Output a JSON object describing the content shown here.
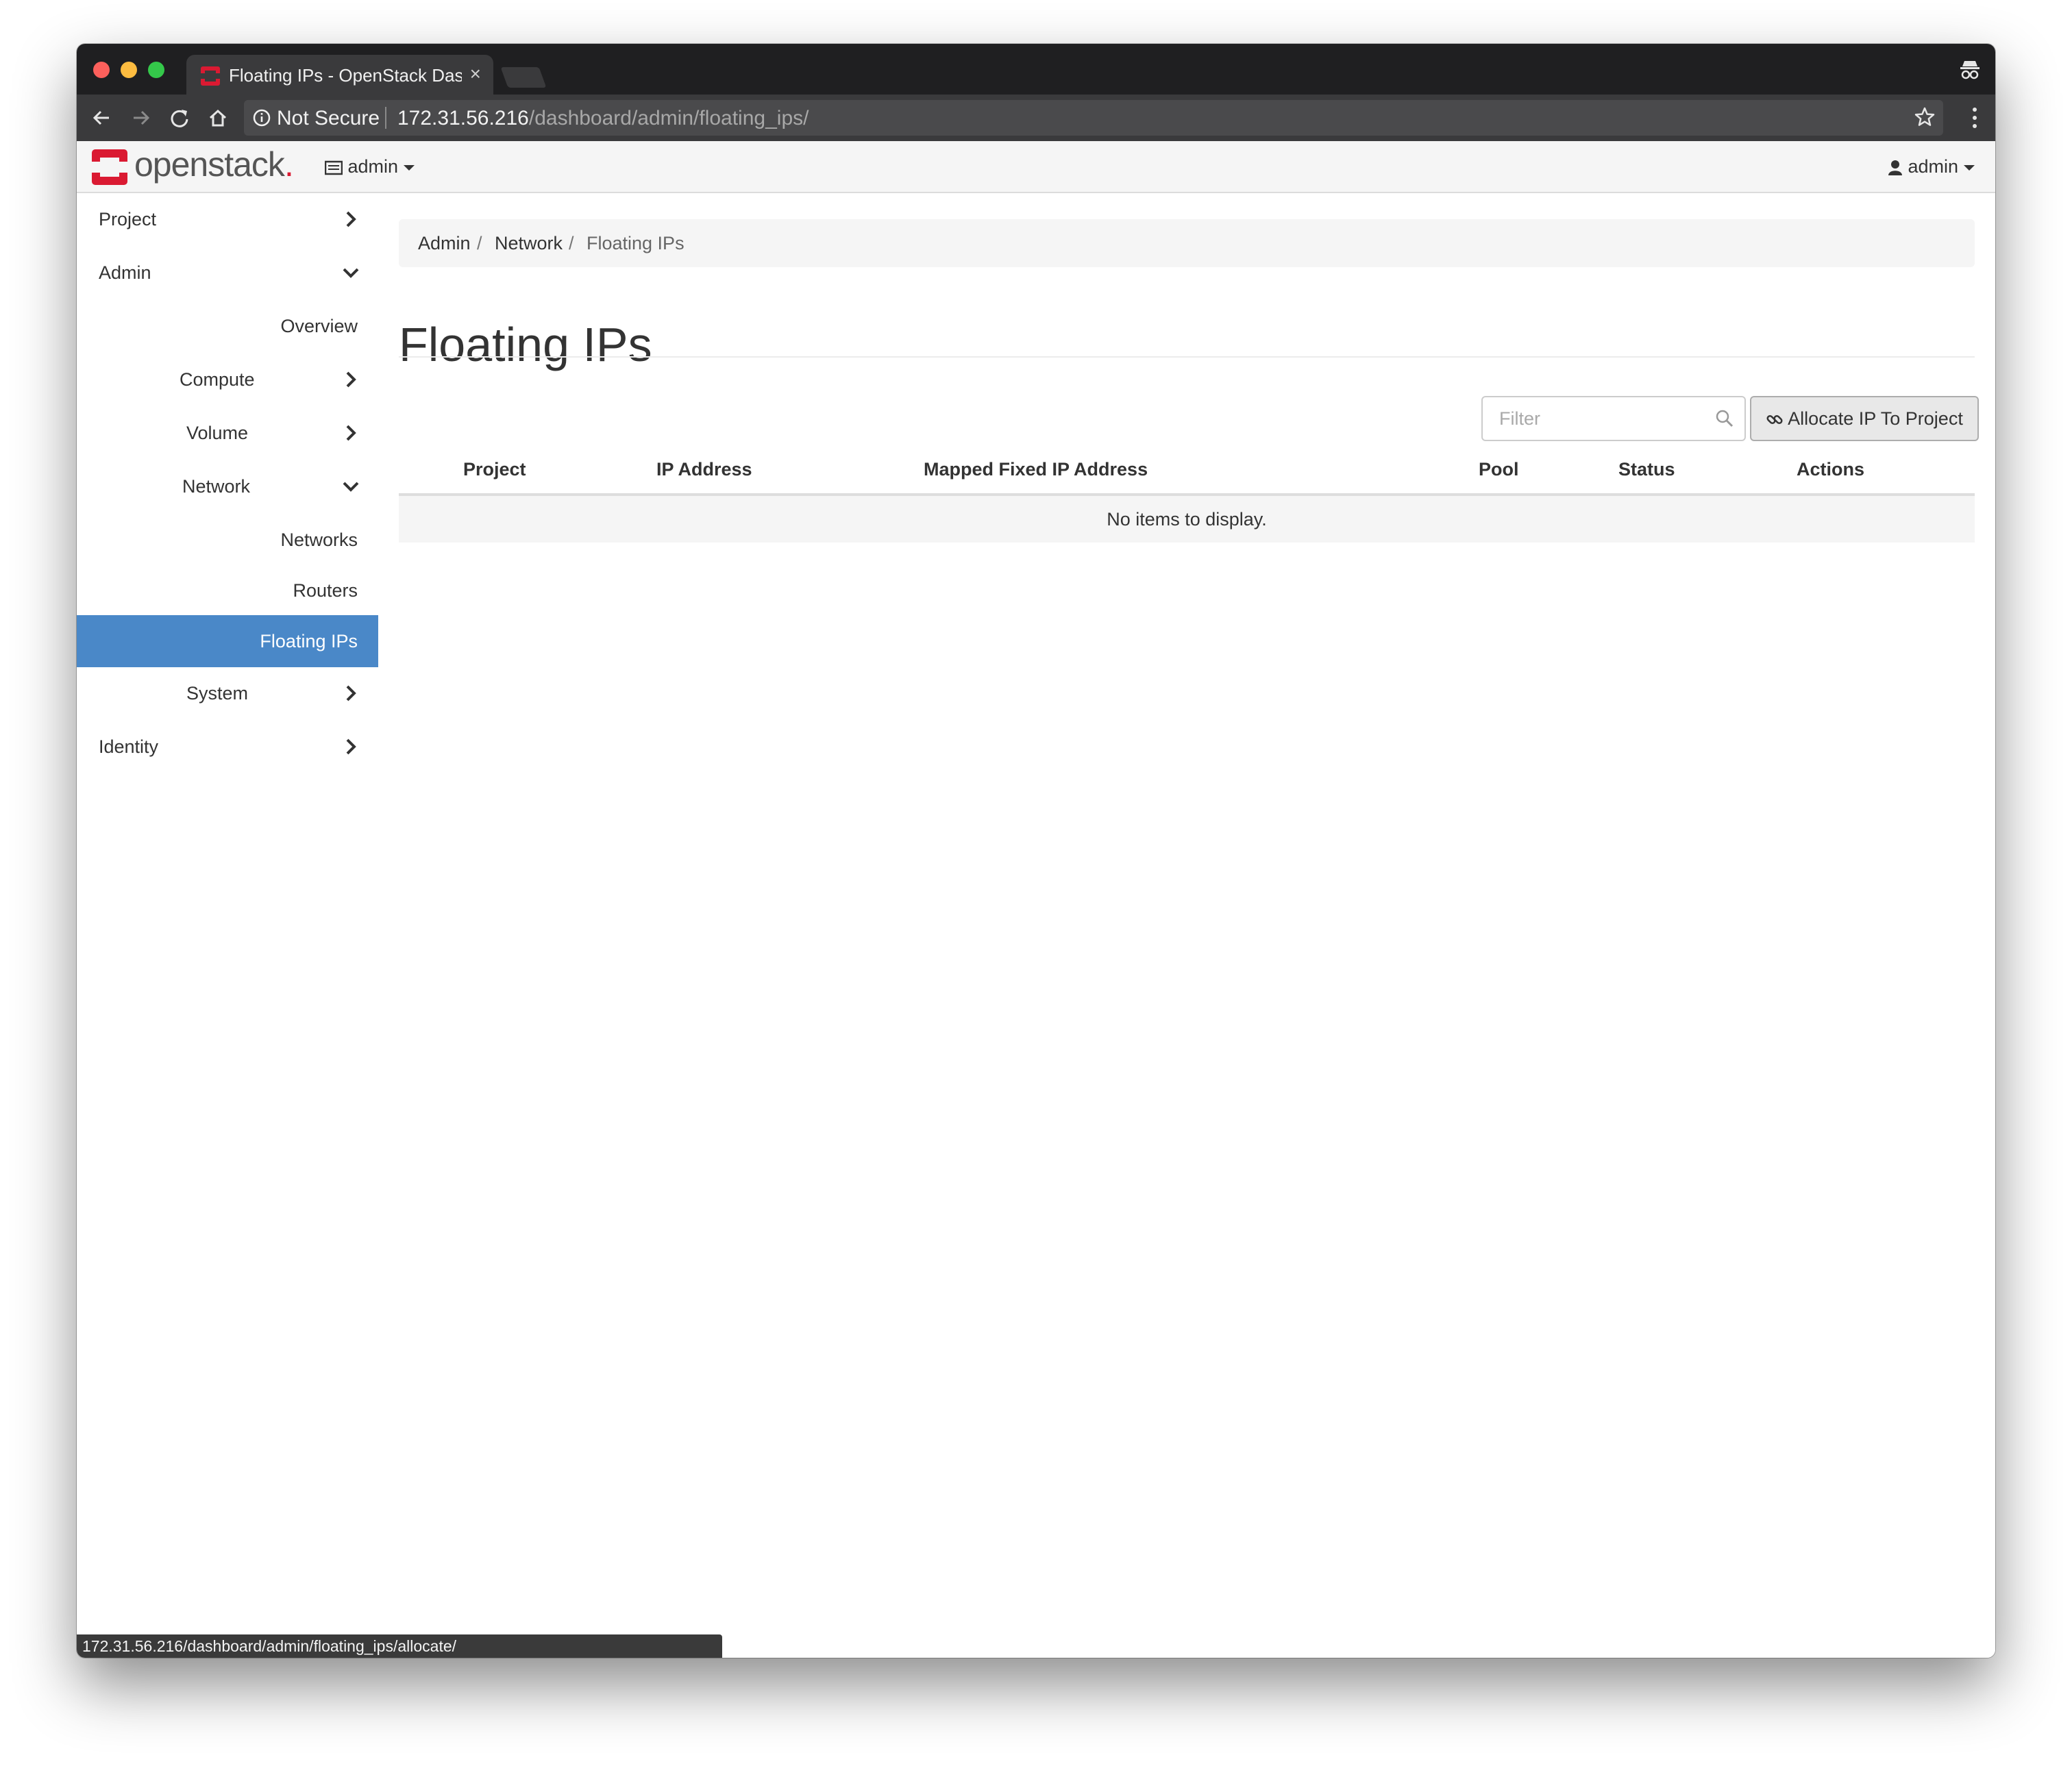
{
  "browser": {
    "tab_title": "Floating IPs - OpenStack Dash",
    "tab_close": "×",
    "security_label": "Not Secure",
    "url_host": "172.31.56.216",
    "url_path": "/dashboard/admin/floating_ips/",
    "status_url": "172.31.56.216/dashboard/admin/floating_ips/allocate/"
  },
  "colors": {
    "accent_active": "#4a88c8",
    "brand_red": "#da1a32"
  },
  "header": {
    "logo_text": "openstack",
    "logo_dot": ".",
    "project_dropdown": "admin",
    "user_dropdown": "admin"
  },
  "sidebar": {
    "items": [
      {
        "label": "Project",
        "icon": "chevron-right-icon"
      },
      {
        "label": "Admin",
        "icon": "chevron-down-icon"
      },
      {
        "label": "Overview"
      },
      {
        "label": "Compute",
        "icon": "chevron-right-icon"
      },
      {
        "label": "Volume",
        "icon": "chevron-right-icon"
      },
      {
        "label": "Network",
        "icon": "chevron-down-icon"
      },
      {
        "label": "Networks"
      },
      {
        "label": "Routers"
      },
      {
        "label": "Floating IPs",
        "active": true
      },
      {
        "label": "System",
        "icon": "chevron-right-icon"
      },
      {
        "label": "Identity",
        "icon": "chevron-right-icon"
      }
    ]
  },
  "breadcrumb": {
    "items": [
      "Admin",
      "Network",
      "Floating IPs"
    ],
    "separator": "/"
  },
  "main": {
    "title": "Floating IPs",
    "filter_placeholder": "Filter",
    "allocate_button": "Allocate IP To Project",
    "table": {
      "columns": [
        "Project",
        "IP Address",
        "Mapped Fixed IP Address",
        "Pool",
        "Status",
        "Actions"
      ],
      "empty_message": "No items to display."
    }
  }
}
